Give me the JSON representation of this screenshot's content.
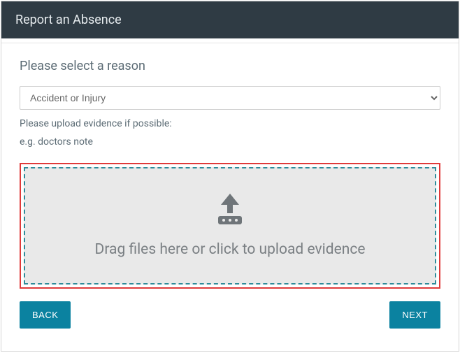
{
  "header": {
    "title": "Report an Absence"
  },
  "body": {
    "section_title": "Please select a reason",
    "reason_select": {
      "selected": "Accident or Injury"
    },
    "upload_hint": "Please upload evidence if possible:",
    "upload_example": "e.g. doctors note",
    "upload_zone_text": "Drag files here or click to upload evidence"
  },
  "footer": {
    "back_label": "BACK",
    "next_label": "NEXT"
  }
}
